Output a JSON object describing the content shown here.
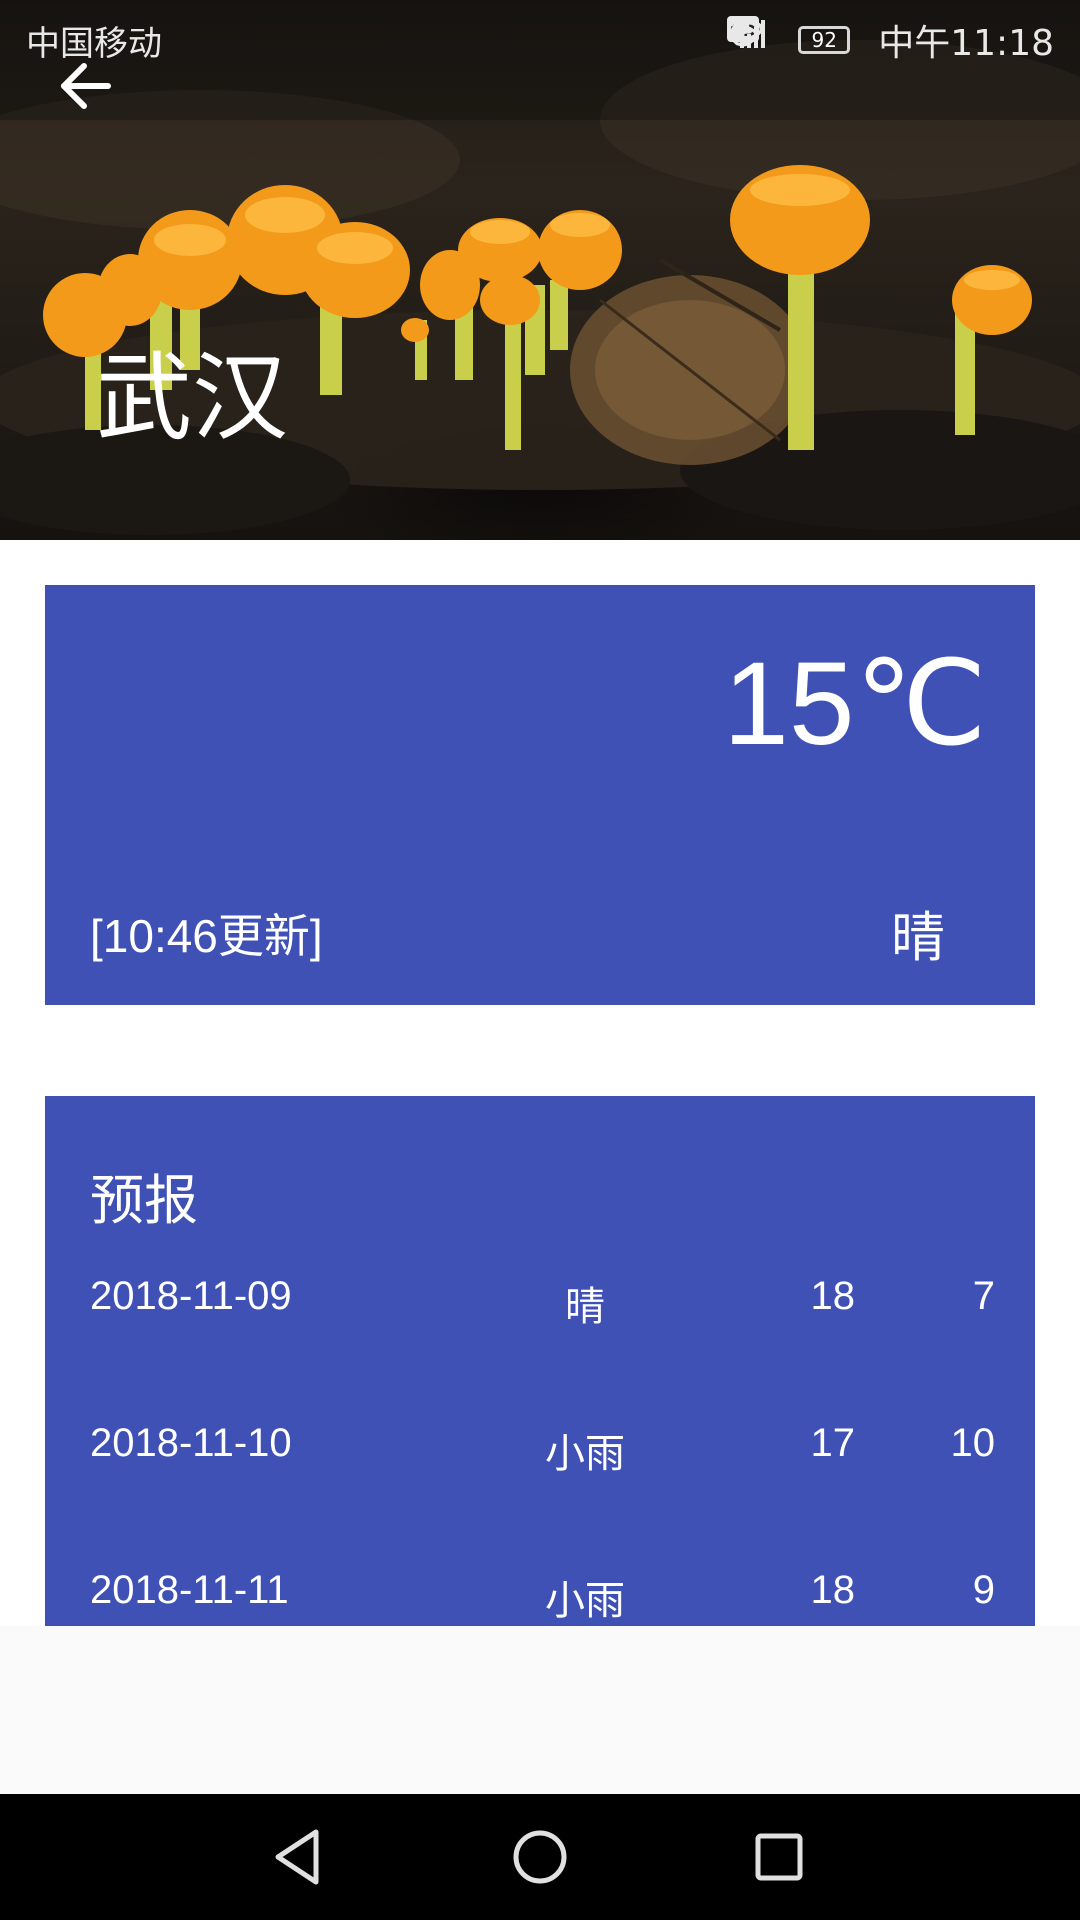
{
  "status_bar": {
    "carrier": "中国移动",
    "battery": "92",
    "time": "中午11:18"
  },
  "header": {
    "city": "武汉"
  },
  "now": {
    "temperature": "15℃",
    "update_time": "[10:46更新]",
    "weather": "晴"
  },
  "forecast": {
    "title": "预报",
    "rows": [
      {
        "date": "2018-11-09",
        "condition": "晴",
        "max": "18",
        "min": "7"
      },
      {
        "date": "2018-11-10",
        "condition": "小雨",
        "max": "17",
        "min": "10"
      },
      {
        "date": "2018-11-11",
        "condition": "小雨",
        "max": "18",
        "min": "9"
      }
    ]
  },
  "colors": {
    "card_blue": "#3f51b5",
    "nav_black": "#000000",
    "mushroom_orange": "#f39a1a"
  },
  "icons": {
    "back": "arrow-left-icon",
    "nav_back": "triangle-back-icon",
    "nav_home": "circle-home-icon",
    "nav_recent": "square-recent-icon"
  }
}
